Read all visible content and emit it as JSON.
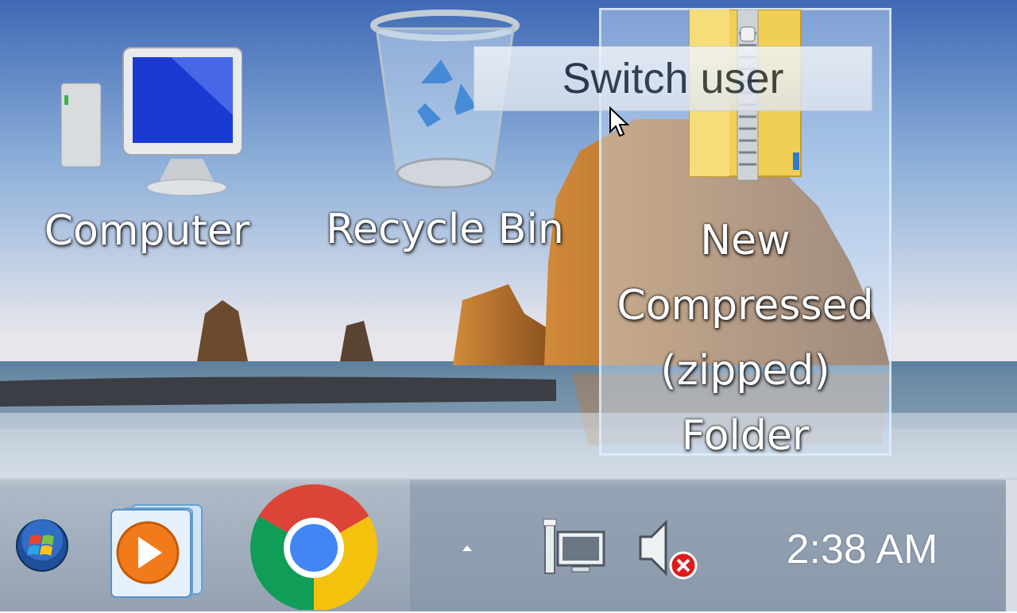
{
  "desktop": {
    "icons": [
      {
        "label": "Computer",
        "icon": "computer-monitor-icon"
      },
      {
        "label": "Recycle Bin",
        "icon": "recycle-bin-icon"
      },
      {
        "label": "New Compressed (zipped) Folder",
        "icon": "zip-folder-icon"
      }
    ]
  },
  "tooltip": {
    "text": "Switch user"
  },
  "taskbar": {
    "start_icon": "windows-orb-icon",
    "pinned": [
      {
        "app": "Windows Media Player",
        "icon": "media-player-icon"
      },
      {
        "app": "Google Chrome",
        "icon": "chrome-icon"
      }
    ],
    "tray": {
      "show_hidden_icon": "chevron-up-icon",
      "network_icon": "network-icon",
      "volume_icon": "volume-muted-icon"
    },
    "clock": "2:38 AM"
  },
  "colors": {
    "taskbar": "#8a99ab",
    "sky_top": "#3f69b5",
    "sea": "#5a7f9e",
    "rock": "#b86a2a"
  }
}
